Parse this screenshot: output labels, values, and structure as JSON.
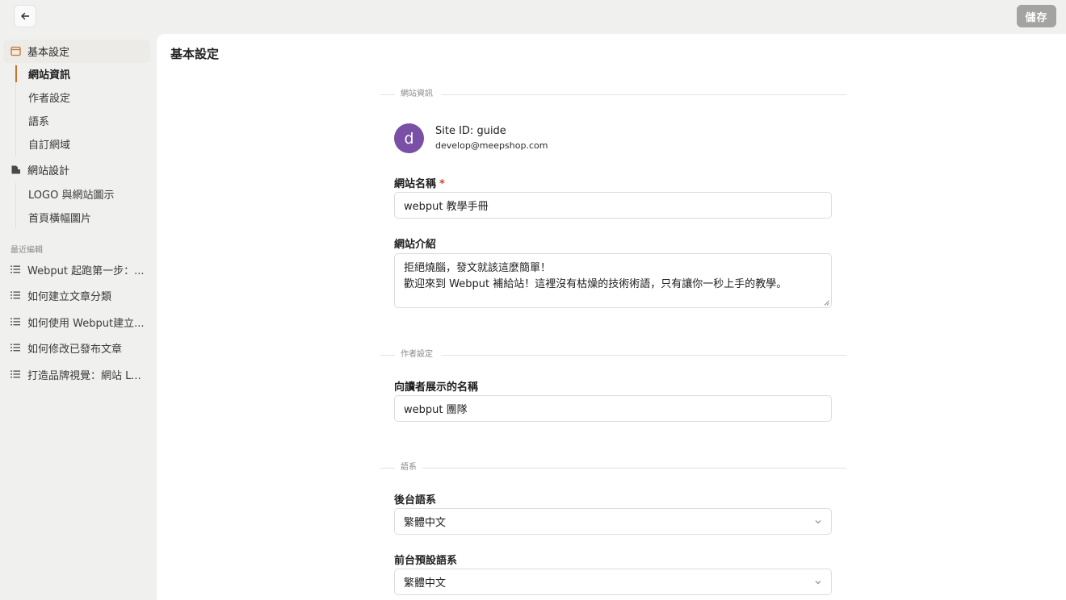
{
  "toolbar": {
    "back_icon": "arrow-left-icon",
    "save_label": "儲存"
  },
  "sidebar": {
    "groups": [
      {
        "label": "基本設定",
        "icon": "calendar-icon",
        "items": [
          "網站資訊",
          "作者設定",
          "語系",
          "自訂網域"
        ]
      },
      {
        "label": "網站設計",
        "icon": "design-icon",
        "items": [
          "LOGO 與網站圖示",
          "首頁橫幅圖片"
        ]
      }
    ],
    "recent_heading": "最近編輯",
    "recent_items": [
      "Webput 起跑第一步：...",
      "如何建立文章分類",
      "如何使用 Webput建立...",
      "如何修改已發布文章",
      "打造品牌視覺：網站 LO..."
    ],
    "recent_icon": "list-icon"
  },
  "main": {
    "title": "基本設定",
    "site_info": {
      "section_label": "網站資訊",
      "avatar_letter": "d",
      "site_id": "Site ID: guide",
      "email": "develop@meepshop.com",
      "name_label": "網站名稱",
      "required_mark": "*",
      "name_value": "webput 教學手冊",
      "intro_label": "網站介紹",
      "intro_line1": "拒絕燒腦，發文就該這麼簡單！",
      "intro_line2": "歡迎來到 Webput 補給站！這裡沒有枯燥的技術術語，只有讓你一秒上手的教學。"
    },
    "author": {
      "section_label": "作者設定",
      "display_name_label": "向讀者展示的名稱",
      "display_name_value": "webput 團隊"
    },
    "language": {
      "section_label": "語系",
      "backend_label": "後台語系",
      "backend_value": "繁體中文",
      "frontend_label": "前台預設語系",
      "frontend_value": "繁體中文"
    }
  },
  "colors": {
    "accent": "#c9742b",
    "avatar": "#7a4fa6",
    "required": "#d0402b",
    "save_button": "#a3a3a1"
  }
}
